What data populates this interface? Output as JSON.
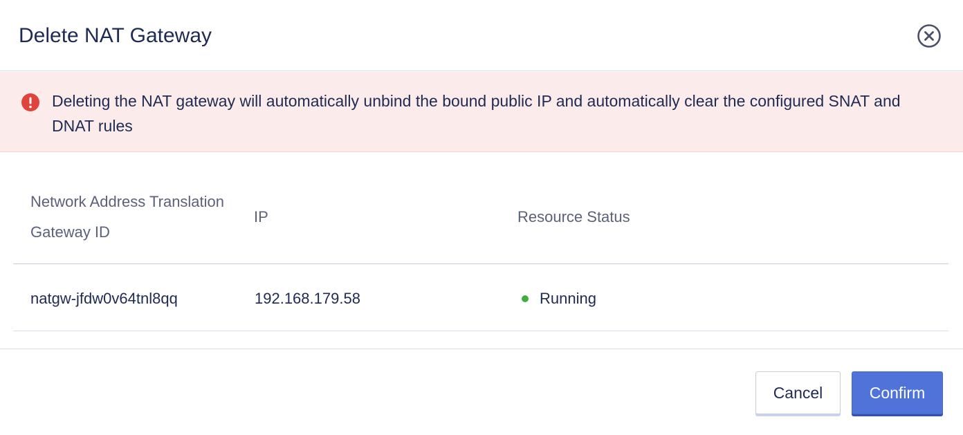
{
  "dialog": {
    "title": "Delete NAT Gateway",
    "close_icon": "close-circle-icon"
  },
  "alert": {
    "icon": "exclamation-circle-icon",
    "message": "Deleting the NAT gateway will automatically unbind the bound public IP and automatically clear the configured SNAT and DNAT rules",
    "color": "#e0433b"
  },
  "table": {
    "headers": {
      "id": "Network Address Translation Gateway ID",
      "ip": "IP",
      "status": "Resource Status"
    },
    "rows": [
      {
        "id": "natgw-jfdw0v64tnl8qq",
        "ip": "192.168.179.58",
        "status": "Running",
        "status_color": "#3fae3f"
      }
    ]
  },
  "footer": {
    "cancel_label": "Cancel",
    "confirm_label": "Confirm",
    "accent": "#4f73d9"
  }
}
